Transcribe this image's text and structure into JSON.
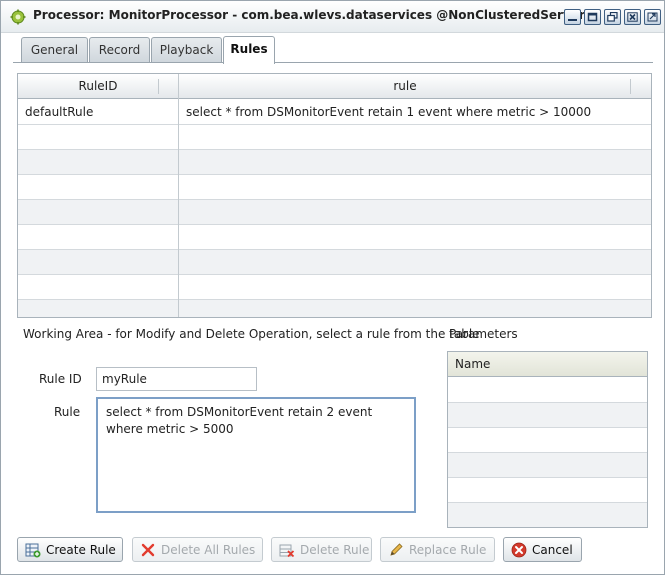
{
  "window": {
    "title": "Processor: MonitorProcessor - com.bea.wlevs.dataservices @NonClusteredServer",
    "controls": [
      "minimize-icon",
      "maximize-icon",
      "restore-icon",
      "close-icon",
      "detach-icon"
    ]
  },
  "tabs": [
    {
      "label": "General",
      "active": false
    },
    {
      "label": "Record",
      "active": false
    },
    {
      "label": "Playback",
      "active": false
    },
    {
      "label": "Rules",
      "active": true
    }
  ],
  "rules_table": {
    "columns": [
      "RuleID",
      "rule"
    ],
    "rows": [
      {
        "id": "defaultRule",
        "rule": "select * from DSMonitorEvent retain 1 event where metric > 10000"
      }
    ]
  },
  "working_area": {
    "caption": "Working Area - for Modify and Delete Operation, select a rule from the table",
    "rule_id_label": "Rule ID",
    "rule_id_value": "myRule",
    "rule_label": "Rule",
    "rule_value": "select * from DSMonitorEvent retain 2 event where metric > 5000"
  },
  "parameters": {
    "caption": "Parameters",
    "columns": [
      "Name"
    ]
  },
  "buttons": {
    "create": "Create Rule",
    "delete_all": "Delete All Rules",
    "delete": "Delete Rule",
    "replace": "Replace Rule",
    "cancel": "Cancel"
  },
  "colors": {
    "accent": "#7c9fc7",
    "cancel_red": "#d33a2c",
    "delete_red": "#e23b2e"
  }
}
